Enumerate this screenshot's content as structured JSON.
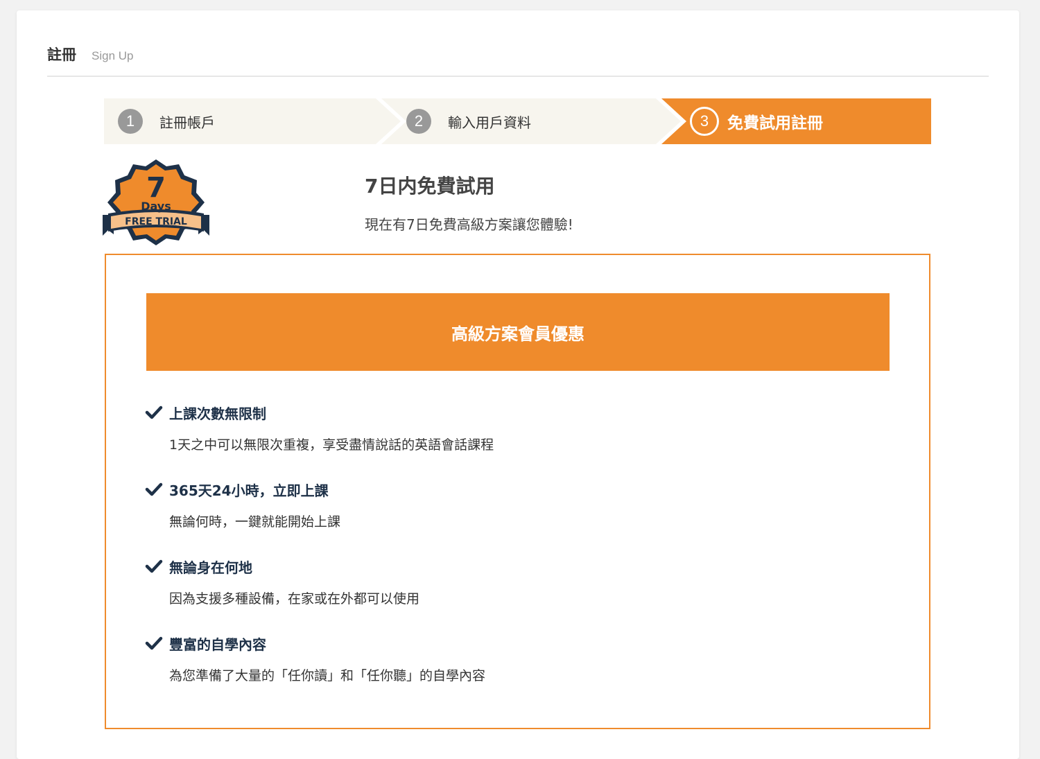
{
  "header": {
    "title": "註冊",
    "subtitle": "Sign Up"
  },
  "steps": [
    {
      "number": "1",
      "label": "註冊帳戶",
      "active": false
    },
    {
      "number": "2",
      "label": "輸入用戶資料",
      "active": false
    },
    {
      "number": "3",
      "label": "免費試用註冊",
      "active": true
    }
  ],
  "badge": {
    "number": "7",
    "word": "Days",
    "ribbon": "FREE TRIAL"
  },
  "intro": {
    "title": "7日内免費試用",
    "text": "現在有7日免費高級方案讓您體驗!"
  },
  "benefits": {
    "header": "高級方案會員優惠",
    "items": [
      {
        "title": "上課次數無限制",
        "desc": "1天之中可以無限次重複，享受盡情說話的英語會話課程"
      },
      {
        "title": "365天24小時，立即上課",
        "desc": "無論何時，一鍵就能開始上課"
      },
      {
        "title": "無論身在何地",
        "desc": "因為支援多種設備，在家或在外都可以使用"
      },
      {
        "title": "豐富的自學內容",
        "desc": "為您準備了大量的「任你讀」和「任你聽」的自學內容"
      }
    ]
  },
  "colors": {
    "accent": "#ef8b2c",
    "step_bg": "#f7f5ee",
    "navy": "#1e3148"
  }
}
